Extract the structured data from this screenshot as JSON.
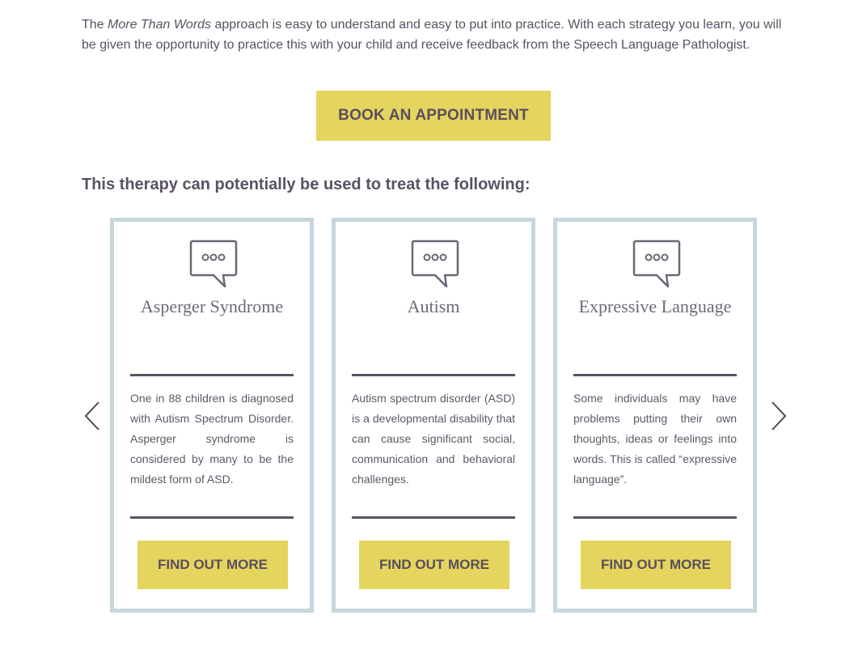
{
  "intro": {
    "prefix": "The ",
    "emphasis": "More Than Words",
    "suffix": " approach is easy to understand and easy to put into practice. With each strategy you learn, you will be given the opportunity to practice this with your child and receive feedback from the Speech Language Pathologist."
  },
  "book_button": {
    "label": "BOOK AN APPOINTMENT"
  },
  "section_heading": "This therapy can potentially be used to treat the following:",
  "carousel": {
    "prev_icon": "chevron-left-icon",
    "next_icon": "chevron-right-icon",
    "cards": [
      {
        "icon": "speech-bubble-icon",
        "title": "Asperger Syndrome",
        "description": "One in 88 children is diagnosed with Autism Spectrum Disorder. Asperger syndrome is considered by many to be the mildest form of ASD.",
        "button_label": "FIND OUT MORE"
      },
      {
        "icon": "speech-bubble-icon",
        "title": "Autism",
        "description": "Autism spectrum disorder (ASD) is a developmental disability that can cause significant social, communication and behavioral challenges.",
        "button_label": "FIND OUT MORE"
      },
      {
        "icon": "speech-bubble-icon",
        "title": "Expressive Language",
        "description": "Some individuals may have problems putting their own thoughts, ideas or feelings into words. This is called “expressive language”.",
        "button_label": "FIND OUT MORE"
      }
    ]
  },
  "colors": {
    "accent_yellow": "#e4d55e",
    "card_border": "#c6d7dd",
    "text": "#5a5263"
  }
}
